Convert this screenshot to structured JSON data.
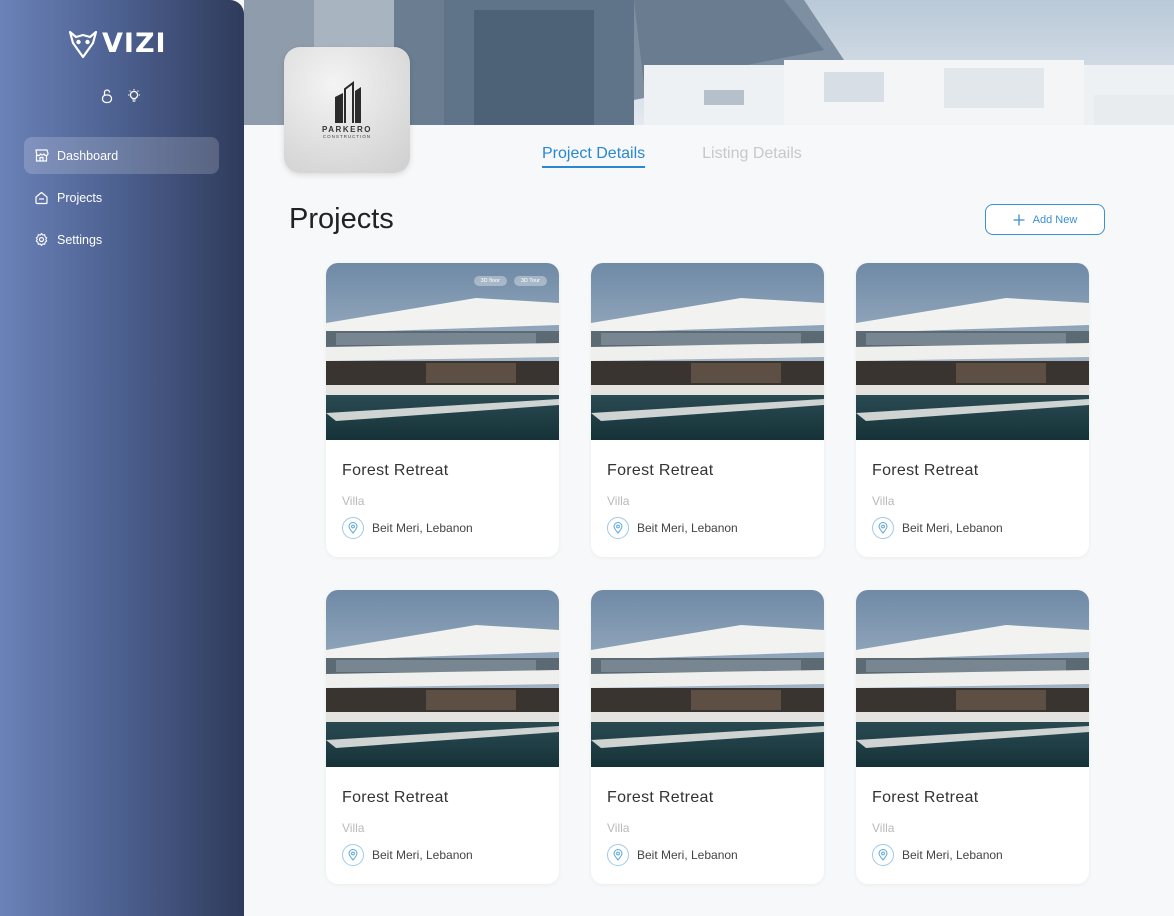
{
  "app": {
    "name": "VIZI"
  },
  "sidebar": {
    "items": [
      {
        "label": "Dashboard",
        "icon": "store-icon",
        "active": true
      },
      {
        "label": "Projects",
        "icon": "house-icon",
        "active": false
      },
      {
        "label": "Settings",
        "icon": "gear-icon",
        "active": false
      }
    ],
    "top_icons": [
      "lock-icon",
      "lightbulb-icon"
    ]
  },
  "company": {
    "name": "PARKERO",
    "subtitle": "CONSTRUCTION"
  },
  "tabs": [
    {
      "label": "Project Details",
      "active": true
    },
    {
      "label": "Listing Details",
      "active": false
    }
  ],
  "main": {
    "title": "Projects",
    "add_button": "Add New"
  },
  "projects": [
    {
      "title": "Forest Retreat",
      "type": "Villa",
      "location": "Beit Meri, Lebanon",
      "badges": [
        "3D floor",
        "3D Tour"
      ]
    },
    {
      "title": "Forest Retreat",
      "type": "Villa",
      "location": "Beit Meri, Lebanon"
    },
    {
      "title": "Forest Retreat",
      "type": "Villa",
      "location": "Beit Meri, Lebanon"
    },
    {
      "title": "Forest Retreat",
      "type": "Villa",
      "location": "Beit Meri, Lebanon"
    },
    {
      "title": "Forest Retreat",
      "type": "Villa",
      "location": "Beit Meri, Lebanon"
    },
    {
      "title": "Forest Retreat",
      "type": "Villa",
      "location": "Beit Meri, Lebanon"
    }
  ],
  "colors": {
    "accent": "#2a87d0",
    "sidebar_start": "#6b82b8",
    "sidebar_end": "#2f3b5c"
  }
}
